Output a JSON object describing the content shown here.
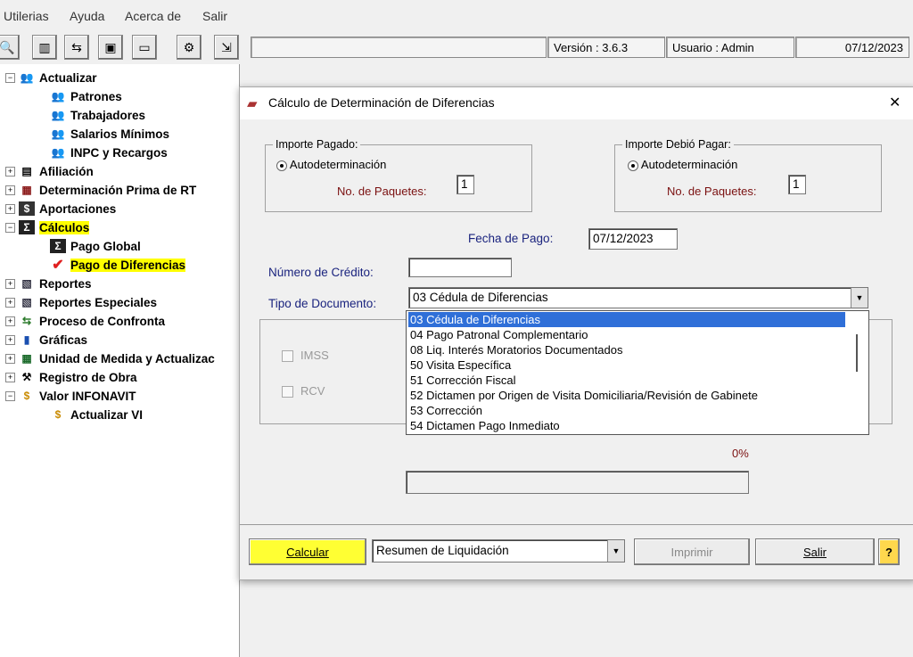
{
  "menu": {
    "items": [
      "Utilerias",
      "Ayuda",
      "Acerca de",
      "Salir"
    ]
  },
  "status": {
    "version": "Versión : 3.6.3",
    "user": "Usuario : Admin",
    "date": "07/12/2023"
  },
  "tree": {
    "items": [
      {
        "label": "Actualizar"
      },
      {
        "label": "Patrones"
      },
      {
        "label": "Trabajadores"
      },
      {
        "label": "Salarios Mínimos"
      },
      {
        "label": "INPC y Recargos"
      },
      {
        "label": "Afiliación"
      },
      {
        "label": "Determinación Prima de RT"
      },
      {
        "label": "Aportaciones"
      },
      {
        "label": "Cálculos"
      },
      {
        "label": "Pago Global"
      },
      {
        "label": "Pago de Diferencias"
      },
      {
        "label": "Reportes"
      },
      {
        "label": "Reportes Especiales"
      },
      {
        "label": "Proceso de Confronta"
      },
      {
        "label": "Gráficas"
      },
      {
        "label": "Unidad de Medida y Actualizac"
      },
      {
        "label": "Registro de Obra"
      },
      {
        "label": "Valor INFONAVIT"
      },
      {
        "label": "Actualizar VI"
      }
    ]
  },
  "dialog": {
    "title": "Cálculo de Determinación de Diferencias",
    "close": "✕",
    "importe_pagado": {
      "legend": "Importe Pagado:",
      "radio_label": "Autodeterminación",
      "paquetes_label": "No. de Paquetes:",
      "paquetes_value": "1"
    },
    "importe_debio": {
      "legend": "Importe Debió Pagar:",
      "radio_label": "Autodeterminación",
      "paquetes_label": "No. de Paquetes:",
      "paquetes_value": "1"
    },
    "fecha_label": "Fecha de Pago:",
    "fecha_value": "07/12/2023",
    "credito_label": "Número de Crédito:",
    "credito_value": "",
    "tipo_label": "Tipo de Documento:",
    "tipo_value": "03 Cédula de Diferencias",
    "options": [
      "03 Cédula de Diferencias",
      "04 Pago Patronal Complementario",
      "08 Liq. Interés Moratorios Documentados",
      "50 Visita Específica",
      "51 Corrección Fiscal",
      "52 Dictamen por Origen de Visita Domiciliaria/Revisión de Gabinete",
      "53 Corrección",
      "54 Dictamen Pago Inmediato"
    ],
    "checks": [
      "IMSS",
      "RCV"
    ],
    "progress_text": "0%",
    "progress_value": 0,
    "buttons": {
      "calcular": "Calcular",
      "resumen": "Resumen de Liquidación",
      "imprimir": "Imprimir",
      "salir": "Salir",
      "help": "?"
    }
  },
  "colors": {
    "highlight": "#ffff00",
    "selection": "#2f6fd8",
    "label_red": "#7a1010",
    "label_blue": "#1a237e"
  }
}
